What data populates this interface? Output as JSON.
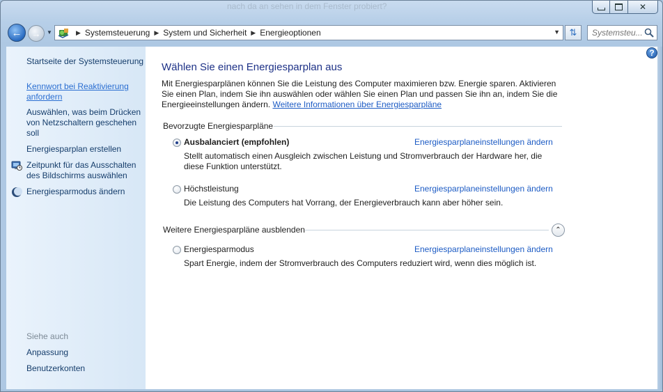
{
  "window": {
    "background_text": "nach da an sehen in dem Fenster probiert?",
    "caption_buttons": {
      "minimize": "▭",
      "maximize": "□",
      "close": "✕"
    }
  },
  "nav": {
    "back_icon": "arrow-left-icon",
    "forward_icon": "arrow-right-icon"
  },
  "address": {
    "crumbs": [
      "Systemsteuerung",
      "System und Sicherheit",
      "Energieoptionen"
    ]
  },
  "search": {
    "placeholder": "Systemsteu..."
  },
  "sidebar": {
    "home_link": "Startseite der Systemsteuerung",
    "links": [
      "Kennwort bei Reaktivierung anfordern",
      "Auswählen, was beim Drücken von Netzschaltern geschehen soll",
      "Energiesparplan erstellen",
      "Zeitpunkt für das Ausschalten des Bildschirms auswählen",
      "Energiesparmodus ändern"
    ],
    "see_also": "Siehe auch",
    "see_also_links": [
      "Anpassung",
      "Benutzerkonten"
    ]
  },
  "main": {
    "title": "Wählen Sie einen Energiesparplan aus",
    "description": "Mit Energiesparplänen können Sie die Leistung des Computer maximieren bzw. Energie sparen. Aktivieren Sie einen Plan, indem Sie ihn auswählen oder wählen Sie einen Plan und passen Sie ihn an, indem Sie die Energieeinstellungen ändern. ",
    "more_info_link": "Weitere Informationen über Energiesparpläne",
    "preferred_header": "Bevorzugte Energiesparpläne",
    "plans": [
      {
        "name": "Ausbalanciert (empfohlen)",
        "desc": "Stellt automatisch einen Ausgleich zwischen Leistung und Stromverbrauch der Hardware her, die diese Funktion unterstützt.",
        "link": "Energiesparplaneinstellungen ändern",
        "selected": true
      },
      {
        "name": "Höchstleistung",
        "desc": "Die Leistung des Computers hat Vorrang, der Energieverbrauch kann aber höher sein.",
        "link": "Energiesparplaneinstellungen ändern",
        "selected": false
      }
    ],
    "more_header": "Weitere Energiesparpläne ausblenden",
    "more_plans": [
      {
        "name": "Energiesparmodus",
        "desc": "Spart Energie, indem der Stromverbrauch des Computers reduziert wird, wenn dies möglich ist.",
        "link": "Energiesparplaneinstellungen ändern",
        "selected": false
      }
    ]
  },
  "colors": {
    "link": "#1c5bc4",
    "title": "#1e3287",
    "sidebar_link": "#153d6b"
  }
}
